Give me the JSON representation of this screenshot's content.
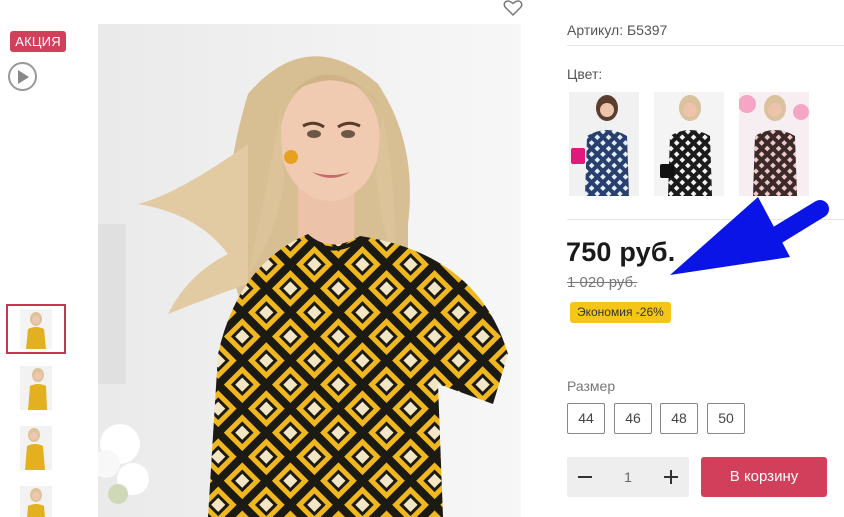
{
  "badge": {
    "sale_label": "АКЦИЯ"
  },
  "product": {
    "sku_text": "Артикул: Б5397",
    "color_label": "Цвет:",
    "price": "750 руб.",
    "old_price": "1 020 руб.",
    "savings_text": "Экономия -26%",
    "size_label": "Размер",
    "sizes": [
      "44",
      "46",
      "48",
      "50"
    ],
    "quantity": "1",
    "cart_button_label": "В корзину"
  },
  "colors": {
    "accent": "#d23f5a",
    "savings_badge": "#f5c518",
    "arrow": "#0a14e6",
    "print_yellow": "#f0b81e"
  },
  "icons": [
    "play-icon",
    "heart-icon",
    "minus-icon",
    "plus-icon",
    "arrow-annotation"
  ]
}
